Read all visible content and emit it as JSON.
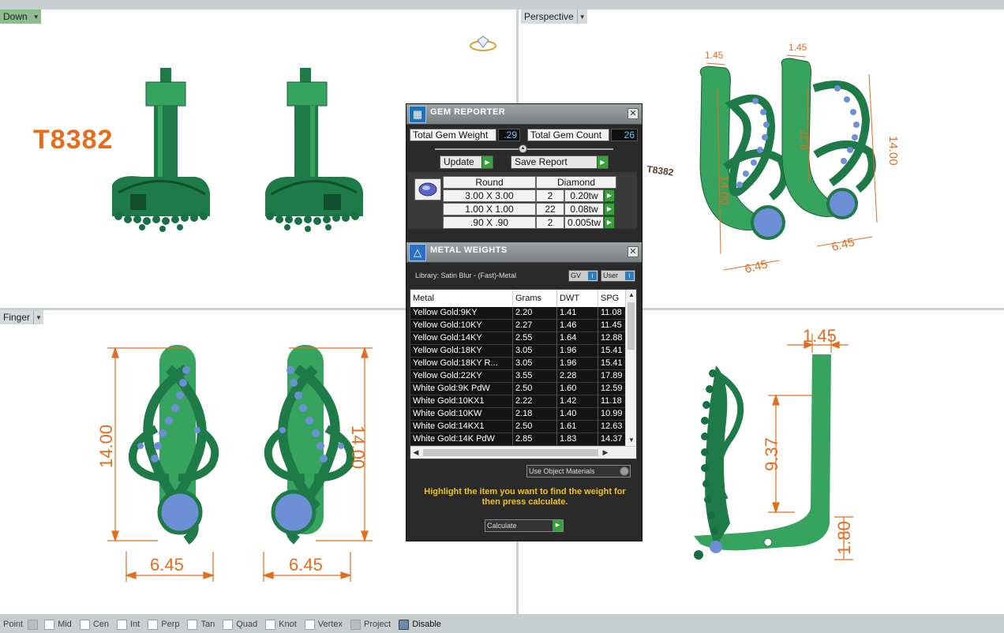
{
  "model_number": "T8382",
  "viewports": {
    "top_left": {
      "name": "Down"
    },
    "top_right": {
      "name": "Perspective"
    },
    "bottom_left": {
      "name": "Finger"
    }
  },
  "dimensions": {
    "a": "1.45",
    "b": "14.00",
    "c": "9.37",
    "d": "6.45",
    "e": "1.80"
  },
  "gem_reporter": {
    "title": "GEM REPORTER",
    "total_gem_weight_label": "Total Gem Weight",
    "total_gem_weight": ".29",
    "total_gem_count_label": "Total Gem Count",
    "total_gem_count": "26",
    "update_label": "Update",
    "save_report_label": "Save Report",
    "shape_header": "Round",
    "type_header": "Diamond",
    "rows": [
      {
        "size": "3.00 X 3.00",
        "count": "2",
        "weight": "0.20tw"
      },
      {
        "size": "1.00 X 1.00",
        "count": "22",
        "weight": "0.08tw"
      },
      {
        "size": ".90 X .90",
        "count": "2",
        "weight": "0.005tw"
      }
    ]
  },
  "metal_weights": {
    "title": "METAL WEIGHTS",
    "library": "Library: Satin Blur - (Fast)-Metal",
    "gv_label": "GV",
    "user_label": "User",
    "columns": [
      "Metal",
      "Grams",
      "DWT",
      "SPG"
    ],
    "rows": [
      [
        "Yellow Gold:9KY",
        "2.20",
        "1.41",
        "11.08"
      ],
      [
        "Yellow Gold:10KY",
        "2.27",
        "1.46",
        "11.45"
      ],
      [
        "Yellow Gold:14KY",
        "2.55",
        "1.64",
        "12.88"
      ],
      [
        "Yellow Gold:18KY",
        "3.05",
        "1.96",
        "15.41"
      ],
      [
        "Yellow Gold:18KY R...",
        "3.05",
        "1.96",
        "15.41"
      ],
      [
        "Yellow Gold:22KY",
        "3.55",
        "2.28",
        "17.89"
      ],
      [
        "White Gold:9K PdW",
        "2.50",
        "1.60",
        "12.59"
      ],
      [
        "White Gold:10KX1",
        "2.22",
        "1.42",
        "11.18"
      ],
      [
        "White Gold:10KW",
        "2.18",
        "1.40",
        "10.99"
      ],
      [
        "White Gold:14KX1",
        "2.50",
        "1.61",
        "12.63"
      ],
      [
        "White Gold:14K PdW",
        "2.85",
        "1.83",
        "14.37"
      ]
    ],
    "use_object_materials": "Use Object Materials",
    "hint": "Highlight the item you want to find the weight for then press calculate.",
    "calculate_label": "Calculate"
  },
  "status_bar": {
    "items": [
      {
        "label": "Point",
        "state": "disabled"
      },
      {
        "label": "Mid",
        "state": "off"
      },
      {
        "label": "Cen",
        "state": "off"
      },
      {
        "label": "Int",
        "state": "off"
      },
      {
        "label": "Perp",
        "state": "off"
      },
      {
        "label": "Tan",
        "state": "off"
      },
      {
        "label": "Quad",
        "state": "off"
      },
      {
        "label": "Knot",
        "state": "off"
      },
      {
        "label": "Vertex",
        "state": "off"
      },
      {
        "label": "Project",
        "state": "disabled"
      },
      {
        "label": "Disable",
        "state": "on"
      }
    ]
  },
  "colors": {
    "metal_green": "#1e7a47",
    "metal_light": "#36a45e",
    "gem_blue": "#6d8fd6",
    "dimension_orange": "#e36c1e"
  }
}
